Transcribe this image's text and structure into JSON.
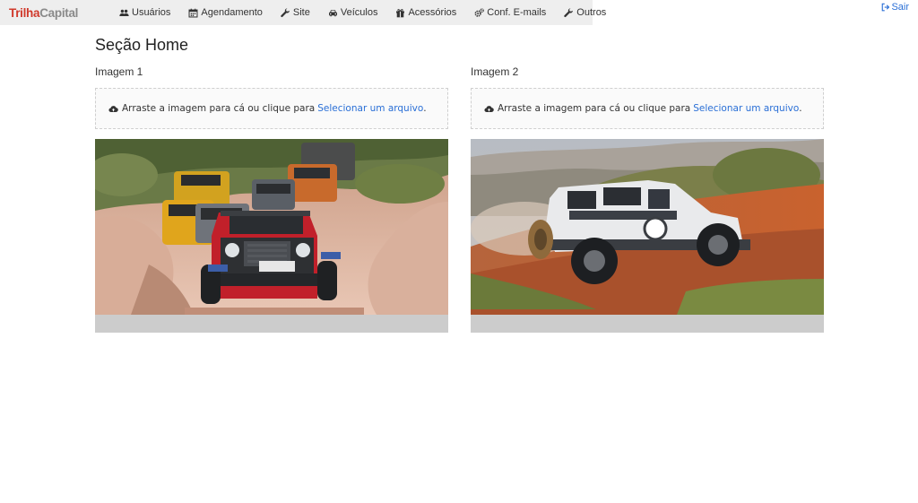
{
  "brand": {
    "part1": "Trilha",
    "part2": "Capital"
  },
  "nav": {
    "items": [
      {
        "label": "Usuários",
        "icon": "users-icon"
      },
      {
        "label": "Agendamento",
        "icon": "calendar-icon"
      },
      {
        "label": "Site",
        "icon": "wrench-icon"
      },
      {
        "label": "Veículos",
        "icon": "car-icon"
      },
      {
        "label": "Acessórios",
        "icon": "gift-icon"
      },
      {
        "label": "Conf. E-mails",
        "icon": "gears-icon"
      },
      {
        "label": "Outros",
        "icon": "wrench-icon"
      }
    ],
    "logout_label": "Sair"
  },
  "page": {
    "title": "Seção Home",
    "image1": {
      "label": "Imagem 1",
      "drop_text": "Arraste a imagem para cá ou clique para",
      "drop_link": "Selecionar um arquivo",
      "drop_suffix": "."
    },
    "image2": {
      "label": "Imagem 2",
      "drop_text": "Arraste a imagem para cá ou clique para",
      "drop_link": "Selecionar um arquivo",
      "drop_suffix": "."
    }
  },
  "colors": {
    "brand_red": "#d0392b",
    "brand_gray": "#8a8a8a",
    "link": "#2a6fd6",
    "nav_bg": "#eeeeee"
  }
}
